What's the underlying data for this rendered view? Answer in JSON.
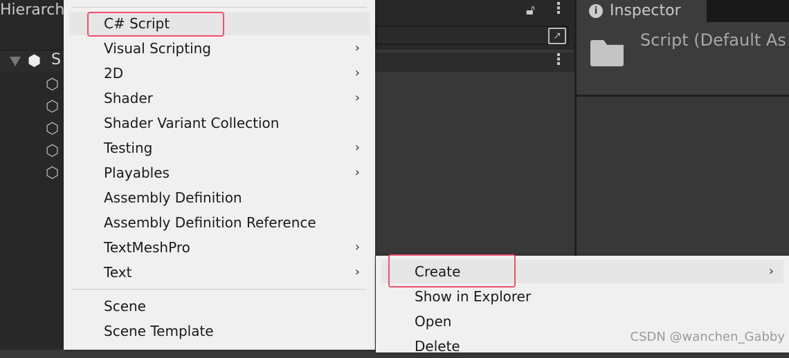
{
  "hierarchy": {
    "title": "Hierarchy",
    "scene_label": "S"
  },
  "inspector": {
    "tab_label": "Inspector",
    "header_title": "Script (Default As"
  },
  "create_menu": {
    "items": [
      {
        "label": "C# Script",
        "submenu": false
      },
      {
        "label": "Visual Scripting",
        "submenu": true
      },
      {
        "label": "2D",
        "submenu": true
      },
      {
        "label": "Shader",
        "submenu": true
      },
      {
        "label": "Shader Variant Collection",
        "submenu": false
      },
      {
        "label": "Testing",
        "submenu": true
      },
      {
        "label": "Playables",
        "submenu": true
      },
      {
        "label": "Assembly Definition",
        "submenu": false
      },
      {
        "label": "Assembly Definition Reference",
        "submenu": false
      },
      {
        "label": "TextMeshPro",
        "submenu": true
      },
      {
        "label": "Text",
        "submenu": true
      }
    ],
    "items2": [
      {
        "label": "Scene"
      },
      {
        "label": "Scene Template"
      }
    ],
    "arrow": "›"
  },
  "context_menu": {
    "items": [
      {
        "label": "Create",
        "submenu": true
      },
      {
        "label": "Show in Explorer"
      },
      {
        "label": "Open"
      },
      {
        "label": "Delete"
      }
    ]
  },
  "watermark": "CSDN @wanchen_Gabby",
  "colors": {
    "highlight_box": "#f0506e"
  }
}
